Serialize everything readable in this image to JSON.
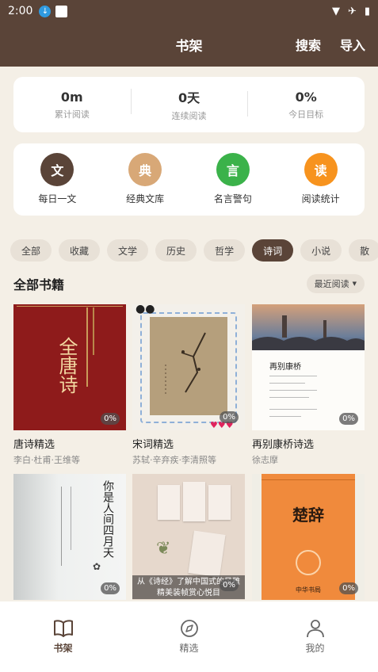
{
  "status_bar": {
    "time": "2:00"
  },
  "app_bar": {
    "title": "书架",
    "search_label": "搜索",
    "import_label": "导入"
  },
  "stats": [
    {
      "value": "0m",
      "label": "累计阅读"
    },
    {
      "value": "0天",
      "label": "连续阅读"
    },
    {
      "value": "0%",
      "label": "今日目标"
    }
  ],
  "shortcuts": [
    {
      "glyph": "文",
      "label": "每日一文",
      "color": "#5a4438"
    },
    {
      "glyph": "典",
      "label": "经典文库",
      "color": "#d8a877"
    },
    {
      "glyph": "言",
      "label": "名言警句",
      "color": "#3bb24a"
    },
    {
      "glyph": "读",
      "label": "阅读统计",
      "color": "#f7931e"
    }
  ],
  "chips": [
    "全部",
    "收藏",
    "文学",
    "历史",
    "哲学",
    "诗词",
    "小说",
    "散"
  ],
  "active_chip": "诗词",
  "section": {
    "title": "全部书籍",
    "sort_label": "最近阅读"
  },
  "books": [
    {
      "name": "唐诗精选",
      "author": "李白·杜甫·王维等",
      "progress": "0%",
      "cover_text": "全唐诗"
    },
    {
      "name": "宋词精选",
      "author": "苏轼·辛弃疾·李清照等",
      "progress": "0%",
      "cover_text": ""
    },
    {
      "name": "再别康桥诗选",
      "author": "徐志摩",
      "progress": "0%",
      "cover_text": "再别康桥"
    },
    {
      "name": "",
      "author": "",
      "progress": "0%",
      "cover_text": "你是人间四月天"
    },
    {
      "name": "",
      "author": "",
      "progress": "0%",
      "cover_text": "从《诗经》了解中国式的风雅"
    },
    {
      "name": "",
      "author": "",
      "progress": "0%",
      "cover_text": "楚辞"
    }
  ],
  "book5_banner_line2": "精美装帧赏心悦目",
  "book6_footer": "中华书局",
  "tabs": [
    {
      "label": "书架",
      "icon": "book-open-icon",
      "active": true
    },
    {
      "label": "精选",
      "icon": "compass-icon",
      "active": false
    },
    {
      "label": "我的",
      "icon": "user-icon",
      "active": false
    }
  ]
}
